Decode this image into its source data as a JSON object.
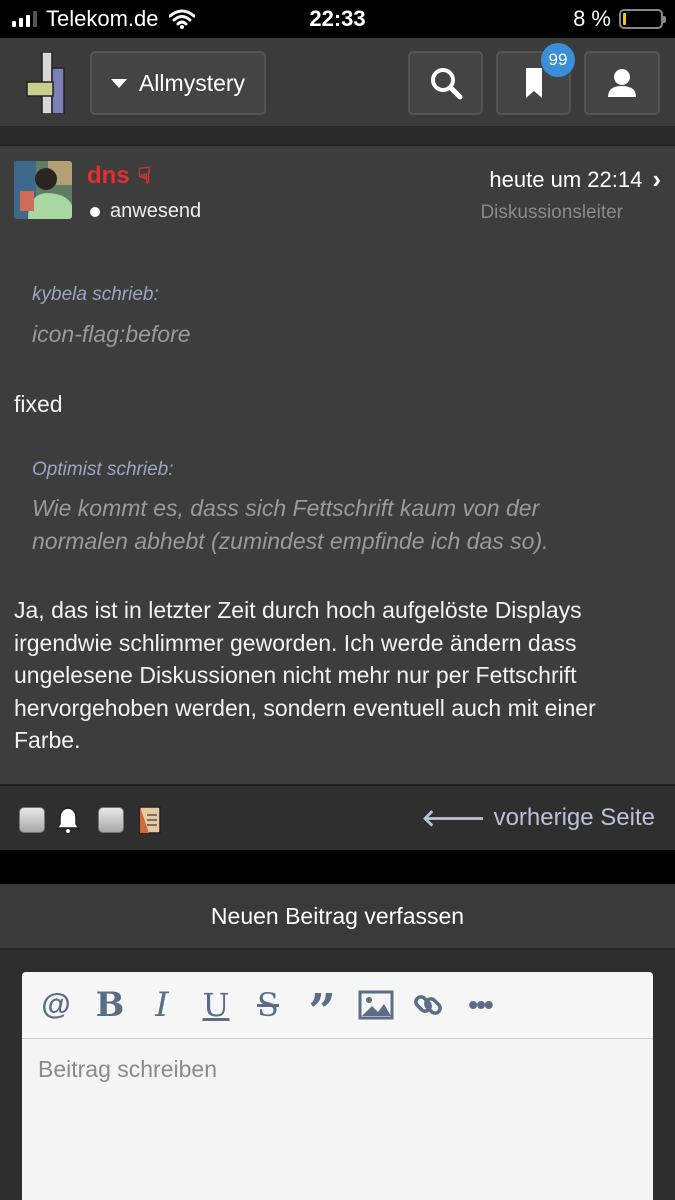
{
  "status_bar": {
    "carrier": "Telekom.de",
    "time": "22:33",
    "battery": "8 %",
    "battery_level": 0.08
  },
  "header": {
    "menu_label": "Allmystery",
    "bookmark_count": "99",
    "icons": [
      "logo",
      "search-icon",
      "bookmark-icon",
      "user-icon"
    ]
  },
  "post": {
    "author": "dns",
    "author_color": "#e03030",
    "status": "anwesend",
    "time": "heute um 22:14",
    "role": "Diskussionsleiter",
    "quote1": {
      "author": "kybela schrieb:",
      "text": "icon-flag:before"
    },
    "reply1": "fixed",
    "quote2": {
      "author": "Optimist schrieb:",
      "text": "Wie kommt es, dass sich Fettschrift kaum von der normalen abhebt (zumindest empfinde ich das so)."
    },
    "reply2": "Ja, das ist in letzter Zeit durch hoch aufgelöste Displays irgendwie schlimmer geworden. Ich werde ändern dass ungelesene Diskussionen nicht mehr nur per Fettschrift hervorgehoben werden, sondern eventuell auch mit einer Farbe."
  },
  "actions": {
    "prev_label": "vorherige Seite"
  },
  "compose": {
    "title": "Neuen Beitrag verfassen",
    "placeholder": "Beitrag schreiben",
    "toolbar": {
      "mention": "@",
      "bold": "B",
      "italic": "I",
      "underline": "U",
      "strike": "S",
      "quote": "”",
      "more": "•••"
    }
  }
}
